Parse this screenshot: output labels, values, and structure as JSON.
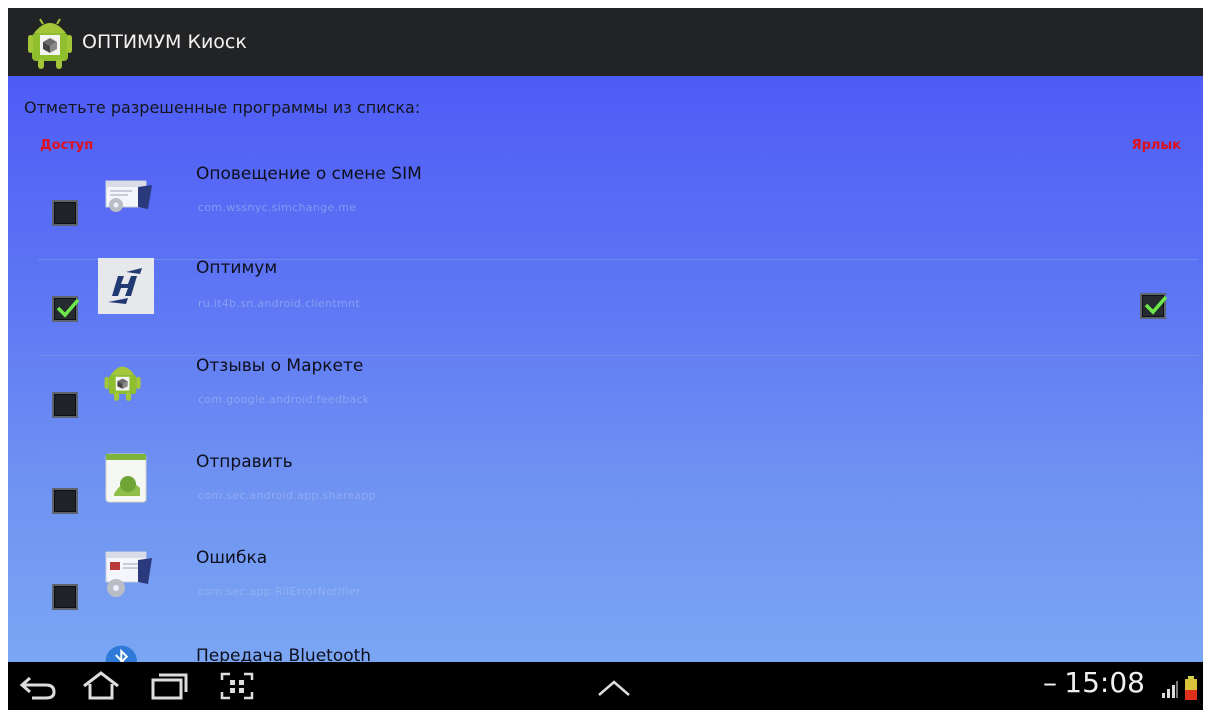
{
  "app": {
    "title": "ОПТИМУМ Киоск"
  },
  "header": {
    "instruction": "Отметьте разрешенные программы из списка:",
    "col_access": "Доступ",
    "col_shortcut": "Ярлык"
  },
  "apps": [
    {
      "title": "Оповещение о смене SIM",
      "package": "com.wssnyc.simchange.me",
      "access": false,
      "shortcut": false,
      "icon": "settings-window-icon"
    },
    {
      "title": "Оптимум",
      "package": "ru.it4b.sn.android.clientmnt",
      "access": true,
      "shortcut": true,
      "icon": "optimum-icon"
    },
    {
      "title": "Отзывы о Маркете",
      "package": "com.google.android.feedback",
      "access": false,
      "shortcut": false,
      "icon": "android-robot-icon"
    },
    {
      "title": "Отправить",
      "package": "com.sec.android.app.shareapp",
      "access": false,
      "shortcut": false,
      "icon": "share-app-icon"
    },
    {
      "title": "Ошибка",
      "package": "com.sec.app.RilErrorNotifier",
      "access": false,
      "shortcut": false,
      "icon": "error-notifier-icon"
    },
    {
      "title": "Передача Bluetooth",
      "package": "",
      "access": false,
      "shortcut": false,
      "icon": "bluetooth-icon"
    }
  ],
  "status": {
    "time": "15:08",
    "separator": "–"
  },
  "nav": [
    "back-icon",
    "home-icon",
    "recent-apps-icon",
    "screenshot-icon",
    "chevron-up-icon"
  ],
  "colors": {
    "accent_red": "#e0101a",
    "check_green": "#6de84a",
    "actionbar": "#222325"
  }
}
